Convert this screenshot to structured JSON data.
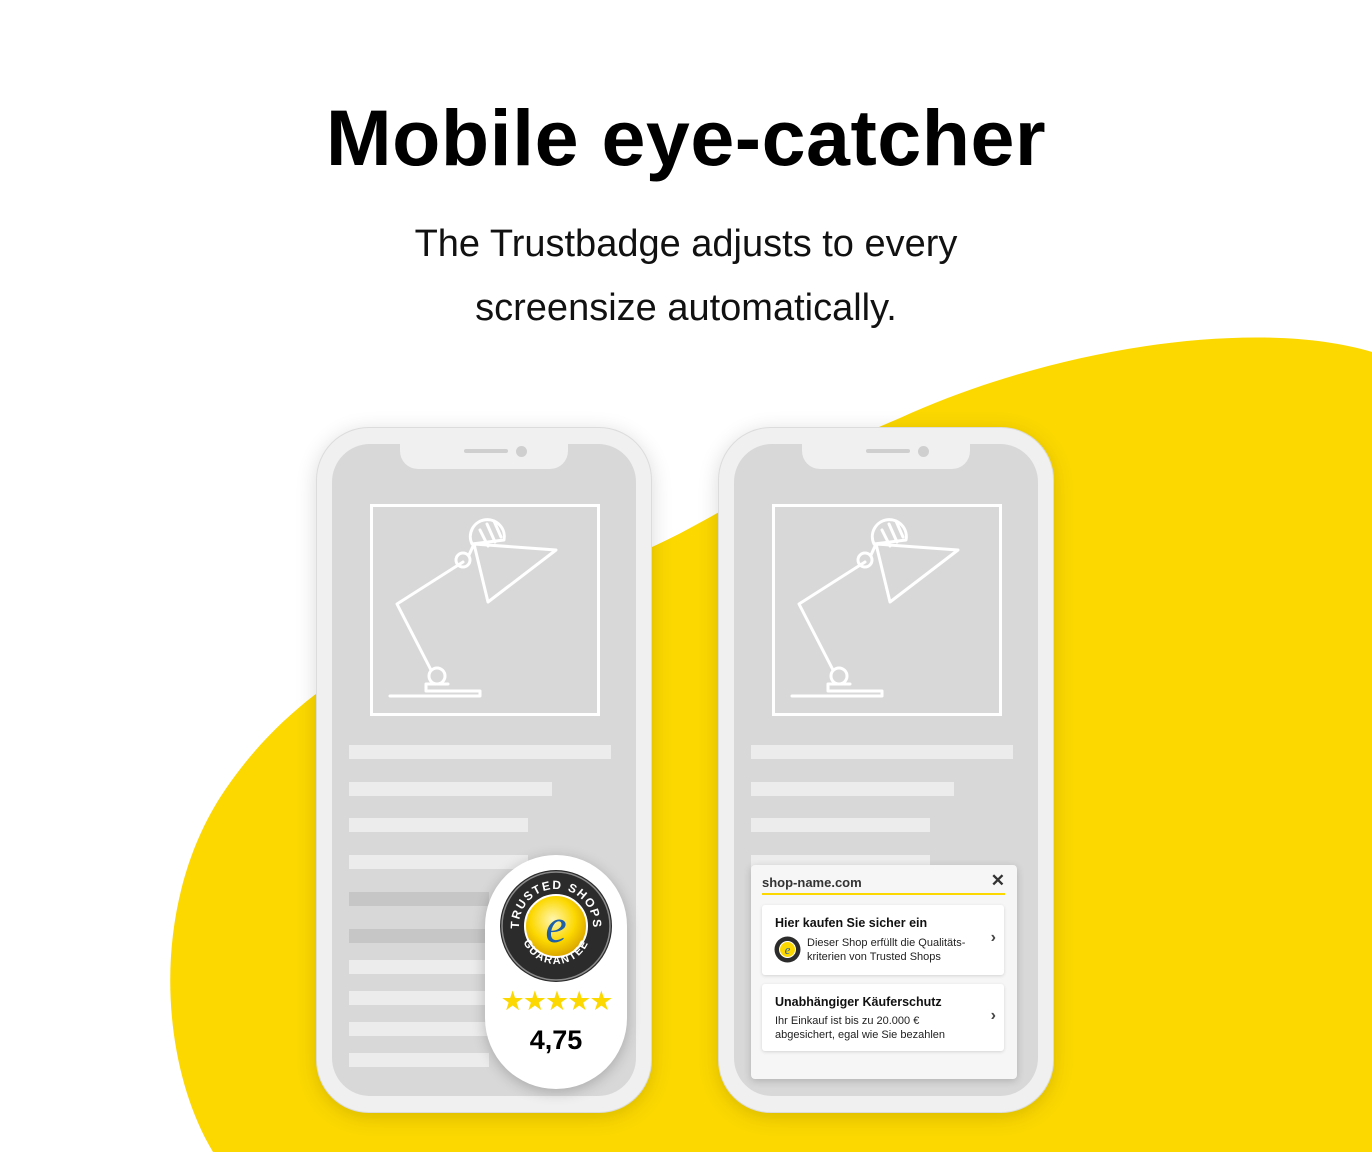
{
  "header": {
    "title": "Mobile eye-catcher",
    "subtitle_line1": "The Trustbadge adjusts to every",
    "subtitle_line2": "screensize automatically."
  },
  "colors": {
    "accent_yellow": "#FCD800",
    "phone_frame": "#F0F0F0",
    "screen": "#D8D8D8"
  },
  "badge": {
    "seal_top_text": "TRUSTED SHOPS",
    "seal_bottom_text": "GUARANTEE",
    "seal_letter": "e",
    "stars": "★★★★★",
    "rating": "4,75"
  },
  "panel": {
    "domain": "shop-name.com",
    "close_icon": "✕",
    "cards": [
      {
        "title": "Hier kaufen Sie sicher ein",
        "line1": "Dieser Shop erfüllt die Qualitäts-",
        "line2": "kriterien von Trusted Shops",
        "chevron": "›"
      },
      {
        "title": "Unabhängiger Käuferschutz",
        "line1": "Ihr Einkauf ist bis zu 20.000 €",
        "line2": "abgesichert, egal wie Sie bezahlen",
        "chevron": "›"
      }
    ]
  }
}
